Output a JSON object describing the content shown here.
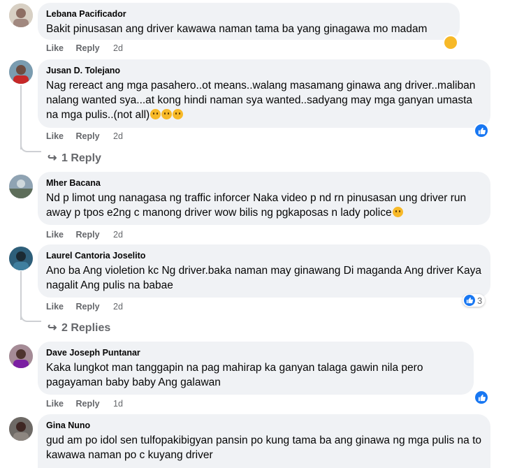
{
  "actions": {
    "like": "Like",
    "reply": "Reply"
  },
  "comments": [
    {
      "author": "Lebana Pacificador",
      "text": "Bakit pinusasan ang driver kawawa naman tama ba yang ginagawa mo madam",
      "time": "2d",
      "reaction": "sad"
    },
    {
      "author": "Jusan D. Tolejano",
      "text": "Nag rereact ang mga pasahero..ot means..walang masamang ginawa ang driver..maliban nalang wanted sya...at kong hindi naman sya wanted..sadyang may mga ganyan umasta na mga pulis..(not all)",
      "time": "2d",
      "reaction": "like",
      "replies": "1 Reply"
    },
    {
      "author": "Mher Bacana",
      "text": "Nd p limot ung nanagasa ng traffic inforcer Naka video p nd rn pinusasan ung driver run away p tpos e2ng c manong driver wow bilis ng pgkaposas n lady police",
      "time": "2d"
    },
    {
      "author": "Laurel Cantoria Joselito",
      "text": "Ano ba Ang violetion kc Ng driver.baka naman may ginawang Di maganda Ang driver Kaya nagalit Ang pulis na babae",
      "time": "2d",
      "reaction": "like",
      "reaction_count": "3",
      "replies": "2 Replies"
    },
    {
      "author": "Dave Joseph Puntanar",
      "text": "Kaka lungkot man tanggapin na pag mahirap ka ganyan talaga gawin nila pero pagayaman baby baby Ang galawan",
      "time": "1d",
      "reaction": "like"
    },
    {
      "author": "Gina Nuno",
      "text": "gud am po idol sen tulfopakibigyan pansin po kung tama ba ang ginawa ng mga pulis na to kawawa naman po c kuyang driver"
    }
  ],
  "colors": {
    "bubble": "#f0f2f5",
    "meta": "#65676b",
    "like_blue": "#1877f2",
    "emoji_yellow": "#f7b928"
  },
  "icons": {
    "like": "thumbs-up-icon",
    "sad": "sad-face-icon",
    "reply_arrow": "reply-arrow-icon"
  }
}
